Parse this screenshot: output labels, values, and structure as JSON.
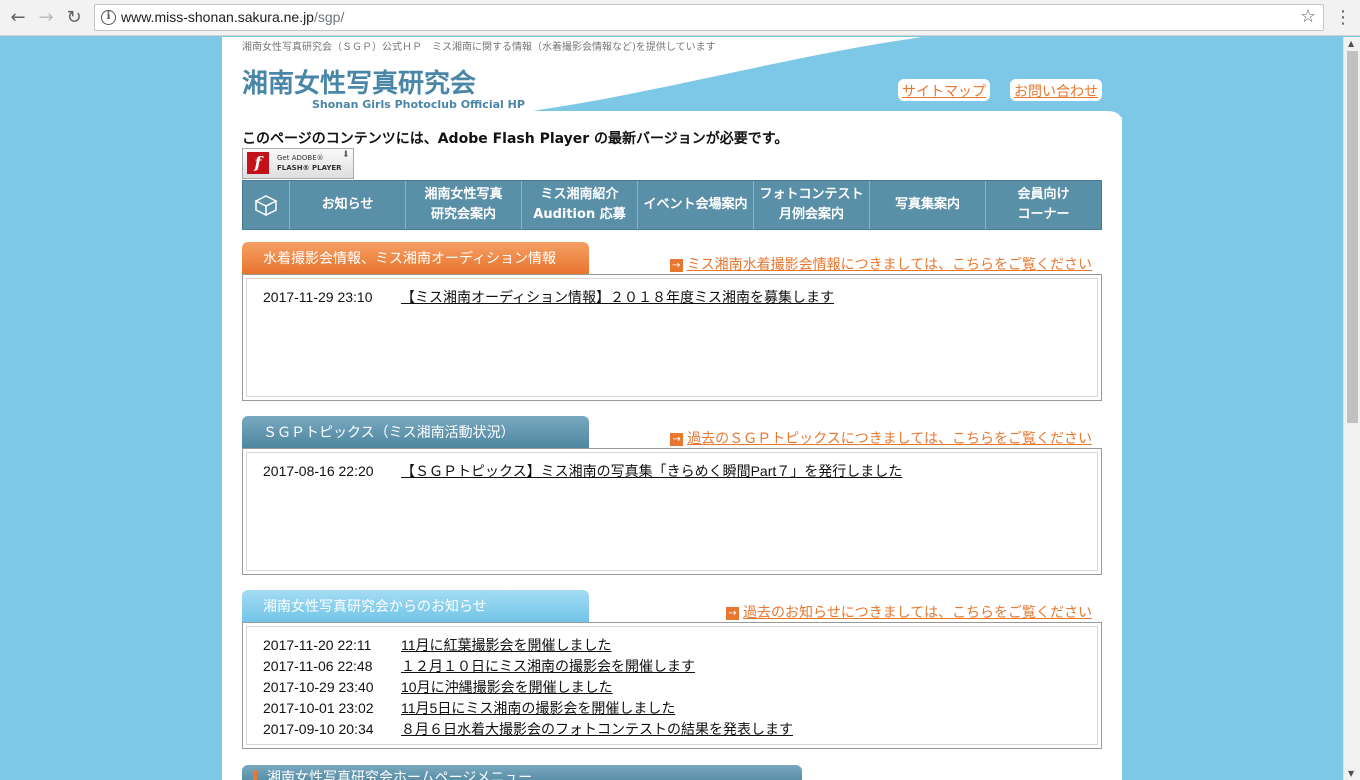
{
  "browser": {
    "url_domain": "www.miss-shonan.sakura.ne.jp",
    "url_path": "/sgp/"
  },
  "header": {
    "tagline": "湘南女性写真研究会（ＳＧＰ）公式ＨＰ　ミス湘南に関する情報（水着撮影会情報など)を提供しています",
    "logo_jp": "湘南女性写真研究会",
    "logo_en": "Shonan Girls Photoclub Official HP",
    "sitemap_link": "サイトマップ",
    "contact_link": "お問い合わせ"
  },
  "flash": {
    "notice": "このページのコンテンツには、Adobe Flash Player の最新バージョンが必要です。",
    "badge_line1": "Get ADOBE®",
    "badge_line2": "FLASH® PLAYER"
  },
  "nav": {
    "items": [
      {
        "line1": "お知らせ",
        "line2": ""
      },
      {
        "line1": "湘南女性写真",
        "line2": "研究会案内"
      },
      {
        "line1": "ミス湘南紹介",
        "line2": "Audition 応募"
      },
      {
        "line1": "イベント会場案内",
        "line2": ""
      },
      {
        "line1": "フォトコンテスト",
        "line2": "月例会案内"
      },
      {
        "line1": "写真集案内",
        "line2": ""
      },
      {
        "line1": "会員向け",
        "line2": "コーナー"
      }
    ]
  },
  "sections": {
    "swimsuit": {
      "title": "水着撮影会情報、ミス湘南オーディション情報",
      "more_link": "ミス湘南水着撮影会情報につきましては、こちらをご覧ください",
      "rows": [
        {
          "date": "2017-11-29 23:10",
          "title": "【ミス湘南オーディション情報】２０１８年度ミス湘南を募集します"
        }
      ]
    },
    "topics": {
      "title": "ＳＧＰトピックス（ミス湘南活動状況）",
      "more_link": "過去のＳＧＰトピックスにつきましては、こちらをご覧ください",
      "rows": [
        {
          "date": "2017-08-16 22:20",
          "title": "【ＳＧＰトピックス】ミス湘南の写真集「きらめく瞬間Part７」を発行しました"
        }
      ]
    },
    "news": {
      "title": "湘南女性写真研究会からのお知らせ",
      "more_link": "過去のお知らせにつきましては、こちらをご覧ください",
      "rows": [
        {
          "date": "2017-11-20 22:11",
          "title": "11月に紅葉撮影会を開催しました"
        },
        {
          "date": "2017-11-06 22:48",
          "title": "１２月１０日にミス湘南の撮影会を開催します"
        },
        {
          "date": "2017-10-29 23:40",
          "title": "10月に沖縄撮影会を開催しました"
        },
        {
          "date": "2017-10-01 23:02",
          "title": "11月5日にミス湘南の撮影会を開催しました"
        },
        {
          "date": "2017-09-10 20:34",
          "title": "８月６日水着大撮影会のフォトコンテストの結果を発表します"
        }
      ]
    },
    "menu": {
      "title": "湘南女性写真研究会ホームページメニュー"
    }
  }
}
